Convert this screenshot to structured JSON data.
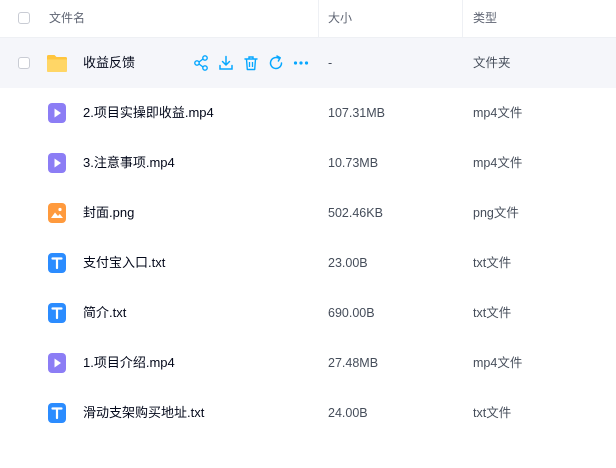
{
  "header": {
    "name_label": "文件名",
    "size_label": "大小",
    "type_label": "类型"
  },
  "files": [
    {
      "name": "收益反馈",
      "size": "-",
      "type": "文件夹",
      "icon": "folder-icon"
    },
    {
      "name": "2.项目实操即收益.mp4",
      "size": "107.31MB",
      "type": "mp4文件",
      "icon": "video-file-icon"
    },
    {
      "name": "3.注意事项.mp4",
      "size": "10.73MB",
      "type": "mp4文件",
      "icon": "video-file-icon"
    },
    {
      "name": "封面.png",
      "size": "502.46KB",
      "type": "png文件",
      "icon": "image-file-icon"
    },
    {
      "name": "支付宝入口.txt",
      "size": "23.00B",
      "type": "txt文件",
      "icon": "text-file-icon"
    },
    {
      "name": "简介.txt",
      "size": "690.00B",
      "type": "txt文件",
      "icon": "text-file-icon"
    },
    {
      "name": "1.项目介绍.mp4",
      "size": "27.48MB",
      "type": "mp4文件",
      "icon": "video-file-icon"
    },
    {
      "name": "滑动支架购买地址.txt",
      "size": "24.00B",
      "type": "txt文件",
      "icon": "text-file-icon"
    }
  ],
  "row_actions": [
    "share-icon",
    "download-icon",
    "delete-icon",
    "move-icon",
    "more-icon"
  ],
  "colors": {
    "accent": "#06a7ff",
    "folder": "#ffc53d",
    "video": "#8c7df5",
    "image": "#ff9a3d",
    "text": "#2b8cff",
    "hover_row": "#f5f6fa"
  }
}
